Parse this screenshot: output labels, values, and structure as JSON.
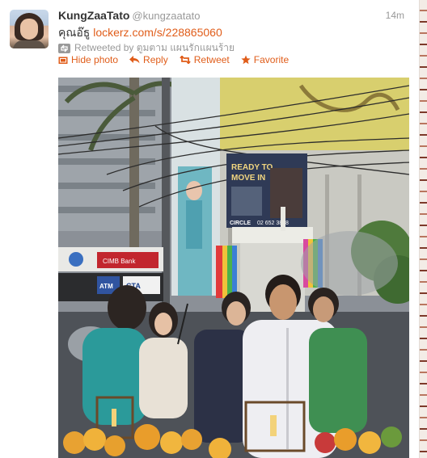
{
  "tweet": {
    "fullname": "KungZaaTato",
    "screen_name": "@kungzaatato",
    "timestamp": "14m",
    "text_prefix": "คุณอ๊ธู ",
    "link": "lockerz.com/s/228865060",
    "retweeted_by": "Retweeted by ตูมตาม แผนรักแผนร้าย"
  },
  "actions": {
    "hide_photo": "Hide photo",
    "reply": "Reply",
    "retweet": "Retweet",
    "favorite": "Favorite"
  },
  "photo": {
    "billboard_line1": "READY TO",
    "billboard_line2": "MOVE IN",
    "billboard_brand": "CIRCLE",
    "billboard_phone": "02 652 3838",
    "sign_cimb": "CIMB Bank",
    "sign_atm": "ATM",
    "sign_cta": "CTA",
    "icons": [
      "rainbow-scarf",
      "white-shrine",
      "lantern"
    ]
  },
  "colors": {
    "link": "#e05d1a",
    "muted": "#999999",
    "text": "#333333"
  }
}
